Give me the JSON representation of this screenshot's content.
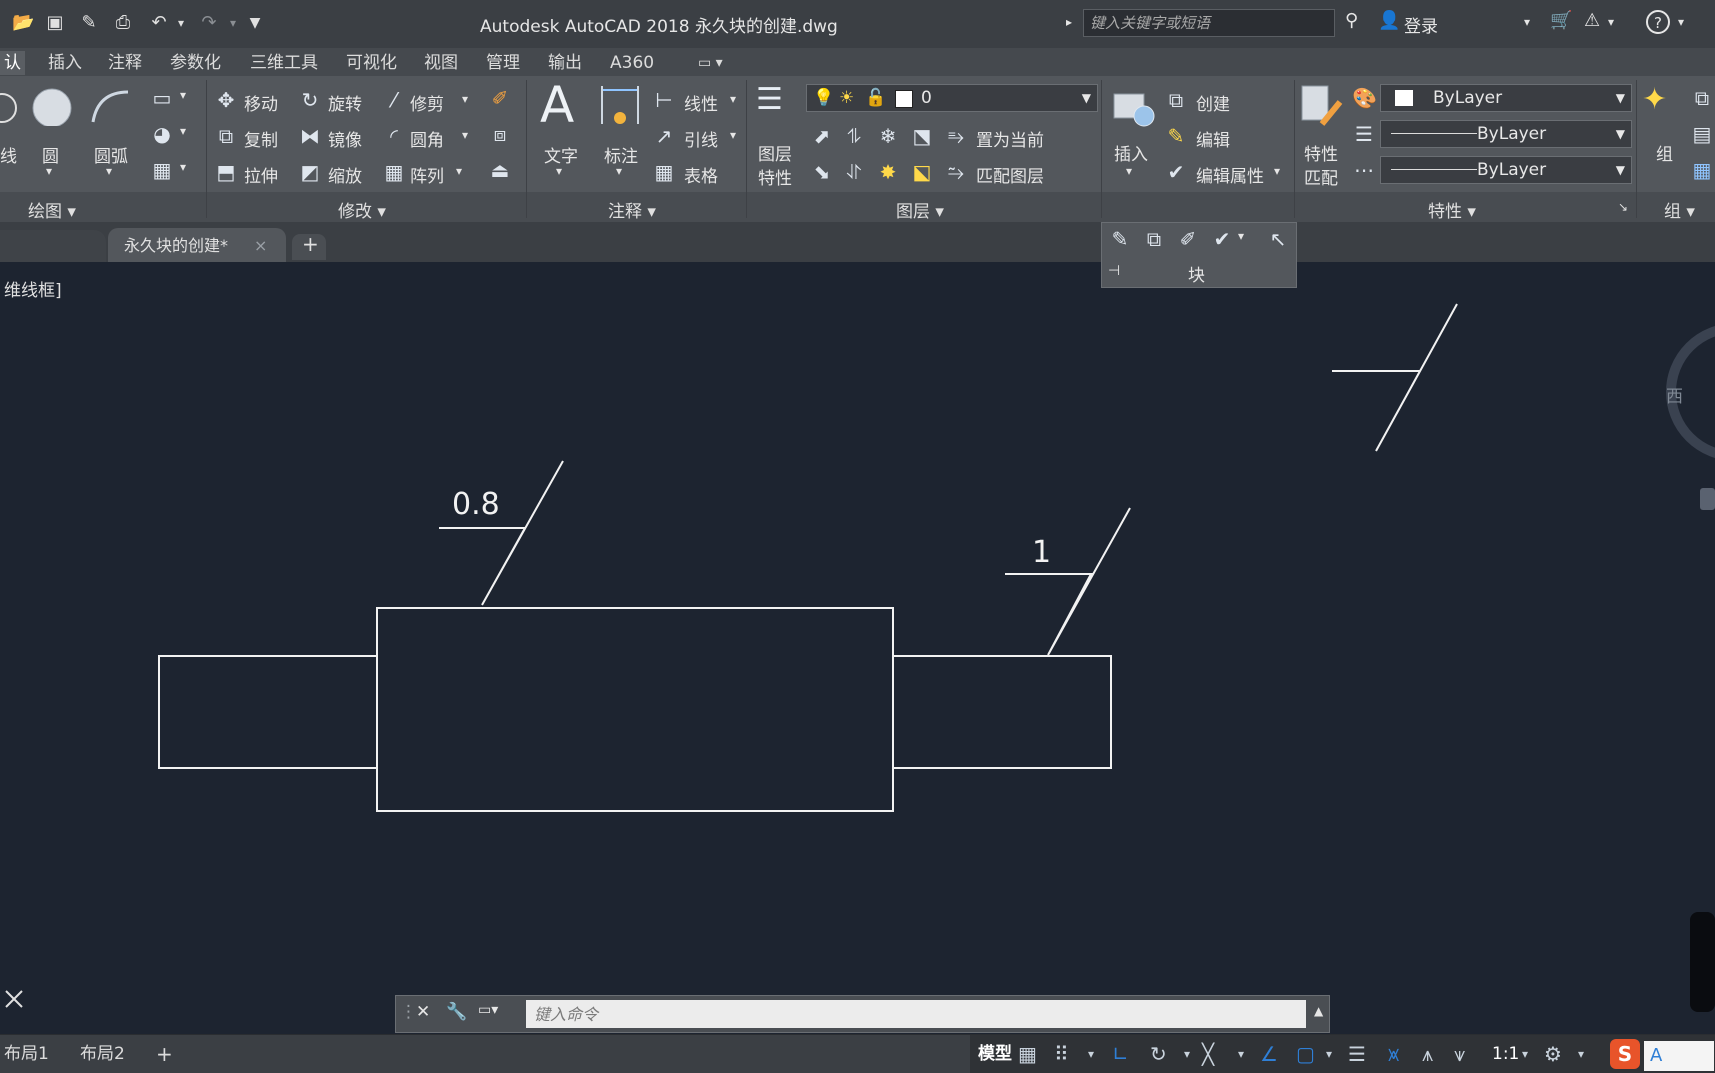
{
  "window": {
    "title": "Autodesk AutoCAD 2018    永久块的创建.dwg"
  },
  "search": {
    "placeholder": "键入关键字或短语"
  },
  "user": {
    "login_label": "登录"
  },
  "help": {
    "label": "?"
  },
  "ribbon_tabs": [
    "认",
    "插入",
    "注释",
    "参数化",
    "三维工具",
    "可视化",
    "视图",
    "管理",
    "输出",
    "A360"
  ],
  "draw_panel": {
    "title": "绘图 ▾",
    "line_label": "线",
    "circle_label": "圆",
    "arc_label": "圆弧"
  },
  "modify_panel": {
    "title": "修改 ▾",
    "move": "移动",
    "rotate": "旋转",
    "trim": "修剪",
    "copy": "复制",
    "mirror": "镜像",
    "fillet": "圆角",
    "stretch": "拉伸",
    "scale": "缩放",
    "array": "阵列"
  },
  "annotation_panel": {
    "title": "注释 ▾",
    "text": "文字",
    "dimension": "标注",
    "linear": "线性",
    "leader": "引线",
    "table": "表格"
  },
  "layers_panel": {
    "title": "图层 ▾",
    "layer_props_1": "图层",
    "layer_props_2": "特性",
    "current_layer": "0",
    "set_current": "置为当前",
    "match_layer": "匹配图层"
  },
  "block_panel": {
    "title": "块",
    "insert": "插入",
    "create": "创建",
    "edit": "编辑",
    "edit_attr": "编辑属性"
  },
  "properties_panel": {
    "title": "特性 ▾",
    "match_1": "特性",
    "match_2": "匹配",
    "color": "ByLayer",
    "linetype": "ByLayer",
    "lineweight": "ByLayer"
  },
  "group_panel": {
    "title": "组 ▾",
    "group": "组"
  },
  "doc_tabs": {
    "active": "永久块的创建*",
    "close": "×",
    "add": "+"
  },
  "viewport": {
    "label": "维线框]"
  },
  "drawing": {
    "roughness_1": "0.8",
    "roughness_2": "1"
  },
  "viewcube": {
    "west": "西"
  },
  "command": {
    "placeholder": "键入命令"
  },
  "layout_tabs": [
    "布局1",
    "布局2"
  ],
  "status": {
    "model": "模型",
    "scale": "1:1"
  },
  "colors": {
    "background": "#1d2430",
    "ribbon": "#53575c",
    "titlebar": "#3b3f44",
    "accent_blue": "#2f7fd6"
  }
}
